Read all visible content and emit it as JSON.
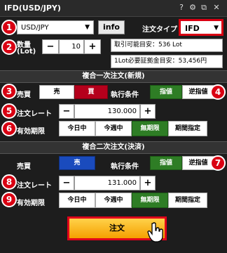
{
  "window": {
    "title": "IFD(USD/JPY)",
    "icons": [
      "help-icon",
      "gear-icon",
      "restore-icon",
      "close-icon"
    ],
    "help_glyph": "?",
    "gear_glyph": "⚙",
    "restore_glyph": "⧉",
    "close_glyph": "✕"
  },
  "badges": [
    "1",
    "2",
    "3",
    "4",
    "5",
    "6",
    "7",
    "8",
    "9"
  ],
  "top": {
    "pair": "USD/JPY",
    "info_label": "info",
    "order_type_label": "注文タイプ",
    "order_type_value": "IFD",
    "qty_label_1": "数量",
    "qty_label_2": "(Lot)",
    "qty_minus": "−",
    "qty_value": "10",
    "qty_plus": "+",
    "tradable": "取引可能目安：536 Lot",
    "margin": "1Lot必要証拠金目安：53,456円"
  },
  "ifd_new": {
    "section": "複合一次注文(新規)",
    "side_label": "売買",
    "sell": "売",
    "buy": "買",
    "exec_label": "執行条件",
    "limit": "指値",
    "stop": "逆指値",
    "rate_label": "注文レート",
    "rate_minus": "−",
    "rate_value": "130.000",
    "rate_plus": "+",
    "expiry_label": "有効期限",
    "expiry": [
      "今日中",
      "今週中",
      "無期限",
      "期間指定"
    ]
  },
  "ifd_close": {
    "section": "複合二次注文(決済)",
    "side_label": "売買",
    "side_value": "売",
    "exec_label": "執行条件",
    "limit": "指値",
    "stop": "逆指値",
    "rate_label": "注文レート",
    "rate_minus": "−",
    "rate_value": "131.000",
    "rate_plus": "+",
    "expiry_label": "有効期限",
    "expiry": [
      "今日中",
      "今週中",
      "無期限",
      "期間指定"
    ]
  },
  "submit": {
    "label": "注文"
  },
  "colors": {
    "accent_red": "#d90012",
    "sell_red": "#b5001c",
    "blue": "#1a4bbd",
    "green": "#2e7d25",
    "order_gold": "#f5a000"
  }
}
